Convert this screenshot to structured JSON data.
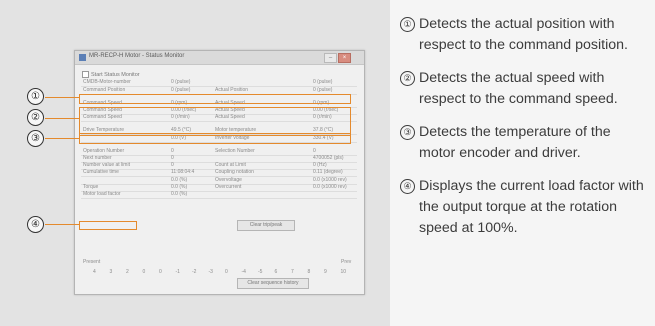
{
  "window": {
    "title": "MR-RECP-H Motor - Status Monitor"
  },
  "controls": {
    "start_monitor": "Start Status Monitor"
  },
  "rows": [
    {
      "left_label": "CMDB-Motor-number",
      "left_value": "0 (pulse)",
      "right_label": "",
      "right_value": "0 (pulse)"
    },
    {
      "left_label": "Command Position",
      "left_value": "0 (pulse)",
      "right_label": "Actual Position",
      "right_value": "0 (pulse)"
    },
    {
      "left_label": "Command Speed",
      "left_value": "0 (rpm)",
      "right_label": "Actual Speed",
      "right_value": "0 (rpm)"
    },
    {
      "left_label": "Command Speed",
      "left_value": "0.00 (r/sec)",
      "right_label": "Actual Speed",
      "right_value": "0.00 (r/sec)"
    },
    {
      "left_label": "Command Speed",
      "left_value": "0 (r/min)",
      "right_label": "Actual Speed",
      "right_value": "0 (r/min)"
    },
    {
      "left_label": "Drive Temperature",
      "left_value": "49.5 (°C)",
      "right_label": "Motor temperature",
      "right_value": "37.8 (°C)"
    },
    {
      "left_label": "",
      "left_value": "0.0 (V)",
      "right_label": "Inverter voltage",
      "right_value": "330.4 (V)"
    },
    {
      "left_label": "Operation Number",
      "left_value": "0",
      "right_label": "Selection Number",
      "right_value": "0"
    },
    {
      "left_label": "Next number",
      "left_value": "0",
      "right_label": "",
      "right_value": "4700052 (pls)"
    },
    {
      "left_label": "Number value at limit",
      "left_value": "0",
      "right_label": "Count at Limit",
      "right_value": "0 (Hz)"
    },
    {
      "left_label": "Cumulative time",
      "left_value": "11:08:04:4",
      "right_label": "Coupling notation",
      "right_value": "0.11 (degree)"
    },
    {
      "left_label": "",
      "left_value": "0.0 (%)",
      "right_label": "Overvoltage",
      "right_value": "0.0 (x1000 rev)"
    },
    {
      "left_label": "Torque",
      "left_value": "0.0 (%)",
      "right_label": "Overcurrent",
      "right_value": "0.0 (x1000 rev)"
    },
    {
      "left_label": "Motor load factor",
      "left_value": "0.0 (%)",
      "right_label": "",
      "right_value": ""
    }
  ],
  "buttons": {
    "clear_trip": "Clear trip/peak",
    "clear_history": "Clear sequence history"
  },
  "scale": {
    "left": "Present",
    "right": "Prev",
    "ticks": [
      "4",
      "3",
      "2",
      "0",
      "0",
      "-1",
      "-2",
      "-3",
      "0",
      "-4",
      "-5",
      "6",
      "7",
      "8",
      "9",
      "10"
    ]
  },
  "callouts": [
    {
      "num": "①",
      "text": "Detects the actual position with respect to the command position."
    },
    {
      "num": "②",
      "text": "Detects the actual speed with respect to the command speed."
    },
    {
      "num": "③",
      "text": "Detects the temperature of the motor encoder and driver."
    },
    {
      "num": "④",
      "text": "Displays the current load factor with the output torque at the rotation speed at 100%."
    }
  ],
  "colors": {
    "highlight": "#e48a2d",
    "text": "#3c3c3c",
    "figure_bg": "#e3e3e3"
  }
}
